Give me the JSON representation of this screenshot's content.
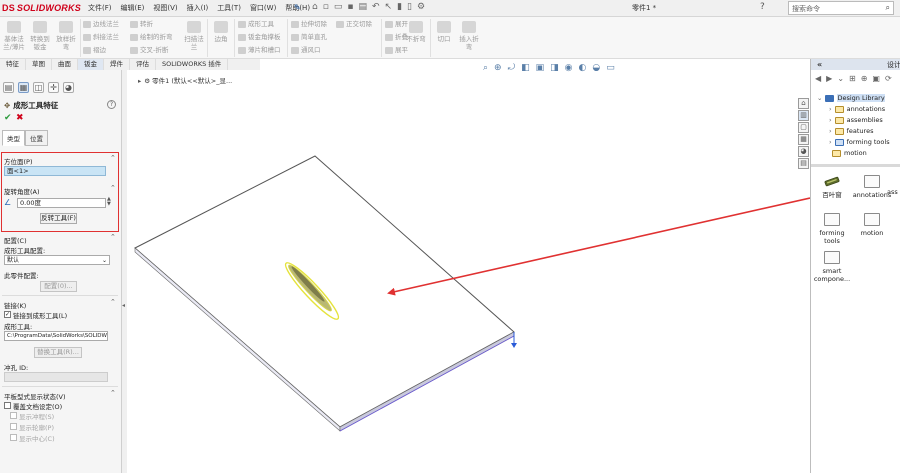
{
  "app": {
    "logo_text": "SOLIDWORKS",
    "logo_prefix": "DS",
    "menu": [
      "文件(F)",
      "编辑(E)",
      "视图(V)",
      "插入(I)",
      "工具(T)",
      "窗口(W)",
      "帮助(H)"
    ],
    "document_title": "零件1 *",
    "search_placeholder": "搜索命令",
    "help_icon_label": "?"
  },
  "ribbon": {
    "groups": [
      {
        "items": [
          "基体法兰/薄片",
          "转换到钣金",
          "放样折弯"
        ]
      },
      {
        "items": [
          "边线法兰",
          "斜接法兰",
          "褶边"
        ]
      },
      {
        "items": [
          "转折",
          "绘制的折弯",
          "交叉-折断"
        ]
      },
      {
        "items": [
          "扫描法兰"
        ]
      },
      {
        "items": [
          "边角"
        ]
      },
      {
        "items": [
          "成形工具",
          "钣金角撑板",
          "薄片和槽口"
        ]
      },
      {
        "items": [
          "拉伸切除",
          "简单直孔",
          "通风口"
        ]
      },
      {
        "items": [
          "正交切除"
        ]
      },
      {
        "items": [
          "展开",
          "折叠",
          "展平"
        ]
      },
      {
        "items": [
          "不折弯"
        ]
      },
      {
        "items": [
          "切口",
          "插入折弯"
        ]
      }
    ]
  },
  "tabs": [
    "特征",
    "草图",
    "曲面",
    "钣金",
    "焊件",
    "评估",
    "SOLIDWORKS 插件"
  ],
  "property_manager": {
    "title": "成形工具特征",
    "help": "?",
    "subtabs": [
      "类型",
      "位置"
    ],
    "orientation_face": {
      "heading": "方位面(P)",
      "value": "面<1>"
    },
    "rotation": {
      "heading": "旋转角度(A)",
      "value": "0.00度",
      "flip_button": "反转工具(F)"
    },
    "config": {
      "heading": "配置(C)",
      "tool_config_label": "成形工具配置:",
      "tool_config_value": "默认",
      "part_config_label": "此零件配置:",
      "config_button": "配置(0)..."
    },
    "link": {
      "heading": "链接(K)",
      "link_checkbox": "链接到成形工具(L)",
      "link_checked": true,
      "tool_label": "成形工具:",
      "tool_path": "C:\\ProgramData\\SolidWorks\\SOLIDWC",
      "replace_button": "替换工具(R)...",
      "punch_label": "冲孔 ID:"
    },
    "flat_display": {
      "heading": "平板型式显示状态(V)",
      "override": "覆盖文档设定(O)",
      "show_punch": "显示冲程(S)",
      "show_profile": "显示轮廓(P)",
      "show_center": "显示中心(C)"
    }
  },
  "viewport": {
    "breadcrumb": "零件1 (默认<<默认>_显..."
  },
  "design_library": {
    "panel_title": "设计",
    "tree": [
      {
        "label": "Design Library",
        "level": 0,
        "selected": true
      },
      {
        "label": "annotations",
        "level": 1
      },
      {
        "label": "assemblies",
        "level": 1
      },
      {
        "label": "features",
        "level": 1
      },
      {
        "label": "forming tools",
        "level": 1
      },
      {
        "label": "motion",
        "level": 1
      }
    ],
    "items": [
      {
        "label": "百叶窗",
        "kind": "part"
      },
      {
        "label": "annotations",
        "kind": "folder"
      },
      {
        "label": "ass",
        "kind": "folder"
      },
      {
        "label": "forming tools",
        "kind": "folder"
      },
      {
        "label": "motion",
        "kind": "folder"
      },
      {
        "label": "smart compone...",
        "kind": "folder"
      }
    ]
  },
  "colors": {
    "accent_red": "#e03131",
    "logo_red": "#d0021b",
    "selection_blue": "#c9e4f5",
    "feature_yellow": "#e5e33b"
  }
}
